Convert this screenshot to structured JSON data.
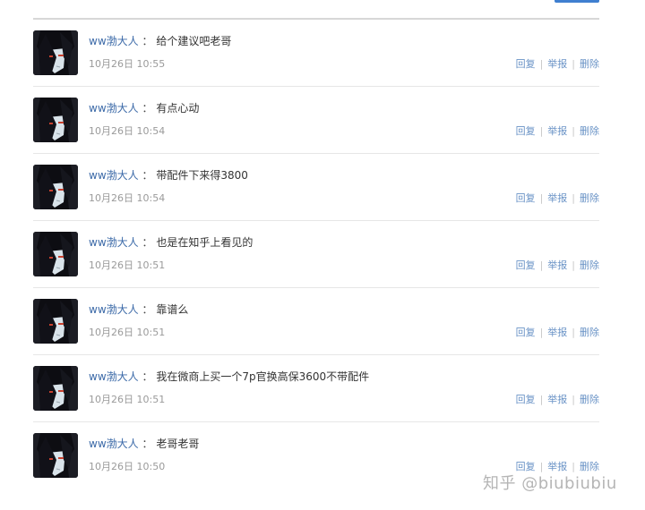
{
  "messages": [
    {
      "user": "ww渤大人",
      "separator": "：",
      "content": "给个建议吧老哥",
      "time": "10月26日 10:55",
      "actions": {
        "reply": "回复",
        "report": "举报",
        "delete": "删除"
      }
    },
    {
      "user": "ww渤大人",
      "separator": "：",
      "content": "有点心动",
      "time": "10月26日 10:54",
      "actions": {
        "reply": "回复",
        "report": "举报",
        "delete": "删除"
      }
    },
    {
      "user": "ww渤大人",
      "separator": "：",
      "content": "带配件下来得3800",
      "time": "10月26日 10:54",
      "actions": {
        "reply": "回复",
        "report": "举报",
        "delete": "删除"
      }
    },
    {
      "user": "ww渤大人",
      "separator": "：",
      "content": "也是在知乎上看见的",
      "time": "10月26日 10:51",
      "actions": {
        "reply": "回复",
        "report": "举报",
        "delete": "删除"
      }
    },
    {
      "user": "ww渤大人",
      "separator": "：",
      "content": "靠谱么",
      "time": "10月26日 10:51",
      "actions": {
        "reply": "回复",
        "report": "举报",
        "delete": "删除"
      }
    },
    {
      "user": "ww渤大人",
      "separator": "：",
      "content": "我在微商上买一个7p官换高保3600不带配件",
      "time": "10月26日 10:51",
      "actions": {
        "reply": "回复",
        "report": "举报",
        "delete": "删除"
      }
    },
    {
      "user": "ww渤大人",
      "separator": "：",
      "content": "老哥老哥",
      "time": "10月26日 10:50",
      "actions": {
        "reply": "回复",
        "report": "举报",
        "delete": "删除"
      }
    }
  ],
  "action_separator": "|",
  "watermark": "知乎 @biubiubiu",
  "icons": {
    "avatar": "anime-character-avatar"
  },
  "colors": {
    "username": "#3c6aa8",
    "action_link": "#6a93c6",
    "timestamp": "#9a9a9a",
    "top_button": "#3f7fd0"
  }
}
